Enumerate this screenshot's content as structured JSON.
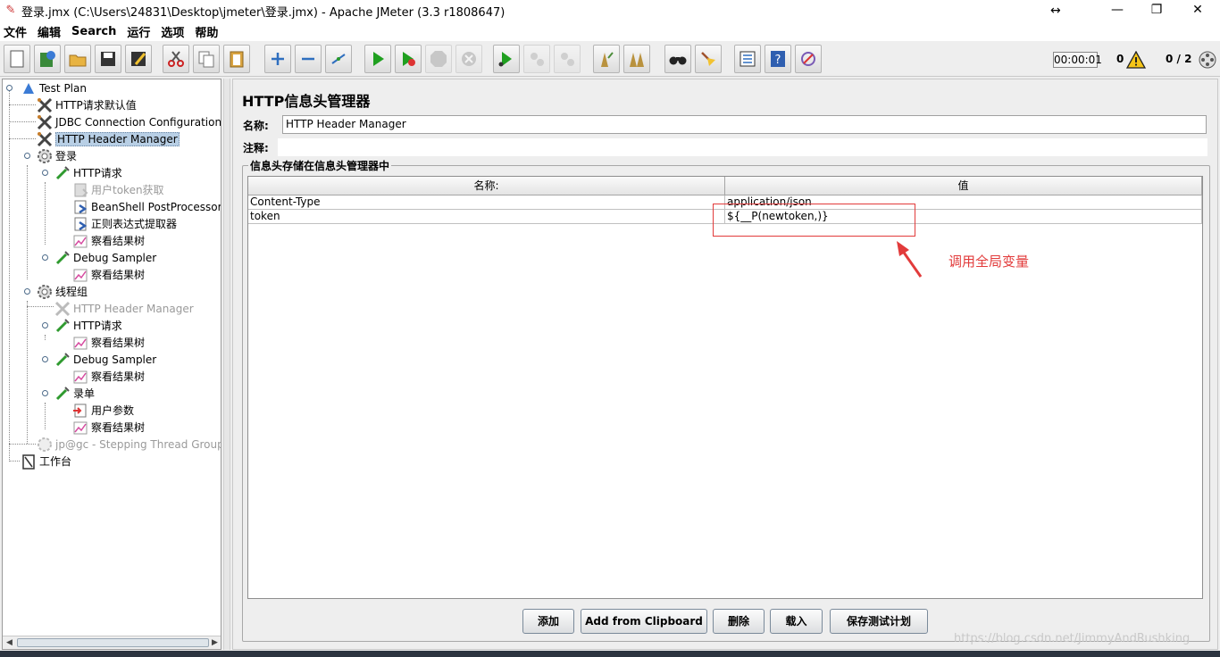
{
  "window": {
    "title": "登录.jmx (C:\\Users\\24831\\Desktop\\jmeter\\登录.jmx) - Apache JMeter (3.3 r1808647)",
    "minimize": "—",
    "restore": "❐",
    "close": "✕",
    "cursor": "↔"
  },
  "menu": [
    "文件",
    "编辑",
    "Search",
    "运行",
    "选项",
    "帮助"
  ],
  "toolbar": {
    "icons": [
      "new-icon",
      "templates-icon",
      "open-icon",
      "save-icon",
      "save-as-icon",
      "cut-icon",
      "copy-icon",
      "paste-icon",
      "expand-icon",
      "collapse-icon",
      "toggle-icon",
      "start-icon",
      "start-no-timers-icon",
      "stop-icon",
      "shutdown-icon",
      "remote-start-icon",
      "remote-stop-icon",
      "remote-shutdown-icon",
      "clear-icon",
      "clear-all-icon",
      "search-icon",
      "reset-search-icon",
      "function-helper-icon",
      "help-icon",
      "log-viewer-icon"
    ],
    "timer": "00:00:01",
    "error_count": "0",
    "thread_count": "0 / 2"
  },
  "tree": [
    {
      "label": "Test Plan",
      "icon": "test-plan-icon"
    },
    {
      "label": "HTTP请求默认值",
      "icon": "config-element-icon"
    },
    {
      "label": "JDBC Connection Configuration",
      "icon": "config-element-icon"
    },
    {
      "label": "HTTP Header Manager",
      "icon": "config-element-icon",
      "selected": true
    },
    {
      "label": "登录",
      "icon": "thread-group-icon"
    },
    {
      "label": "HTTP请求",
      "icon": "sampler-icon"
    },
    {
      "label": "用户token获取",
      "icon": "post-processor-icon",
      "disabled": true
    },
    {
      "label": "BeanShell PostProcessor",
      "icon": "post-processor-icon"
    },
    {
      "label": "正则表达式提取器",
      "icon": "post-processor-icon"
    },
    {
      "label": "察看结果树",
      "icon": "listener-icon"
    },
    {
      "label": "Debug Sampler",
      "icon": "sampler-icon"
    },
    {
      "label": "察看结果树",
      "icon": "listener-icon"
    },
    {
      "label": "线程组",
      "icon": "thread-group-icon"
    },
    {
      "label": "HTTP Header Manager",
      "icon": "config-element-icon",
      "disabled": true
    },
    {
      "label": "HTTP请求",
      "icon": "sampler-icon"
    },
    {
      "label": "察看结果树",
      "icon": "listener-icon"
    },
    {
      "label": "Debug Sampler",
      "icon": "sampler-icon"
    },
    {
      "label": "察看结果树",
      "icon": "listener-icon"
    },
    {
      "label": "录单",
      "icon": "sampler-icon"
    },
    {
      "label": "用户参数",
      "icon": "pre-processor-icon"
    },
    {
      "label": "察看结果树",
      "icon": "listener-icon"
    },
    {
      "label": "jp@gc - Stepping Thread Group",
      "icon": "thread-group-icon",
      "disabled": true
    },
    {
      "label": "工作台",
      "icon": "workbench-icon"
    }
  ],
  "panel": {
    "title": "HTTP信息头管理器",
    "name_label": "名称:",
    "name_value": "HTTP Header Manager",
    "comment_label": "注释:",
    "group_title": "信息头存储在信息头管理器中",
    "table": {
      "headers": [
        "名称:",
        "值"
      ],
      "rows": [
        [
          "Content-Type",
          "application/json"
        ],
        [
          "token",
          "${__P(newtoken,)}"
        ]
      ]
    },
    "buttons": [
      "添加",
      "Add from Clipboard",
      "删除",
      "载入",
      "保存测试计划"
    ]
  },
  "annotation": {
    "text": "调用全局变量",
    "color": "#e23b3b"
  },
  "watermark": "https://blog.csdn.net/JimmyAndRushking"
}
